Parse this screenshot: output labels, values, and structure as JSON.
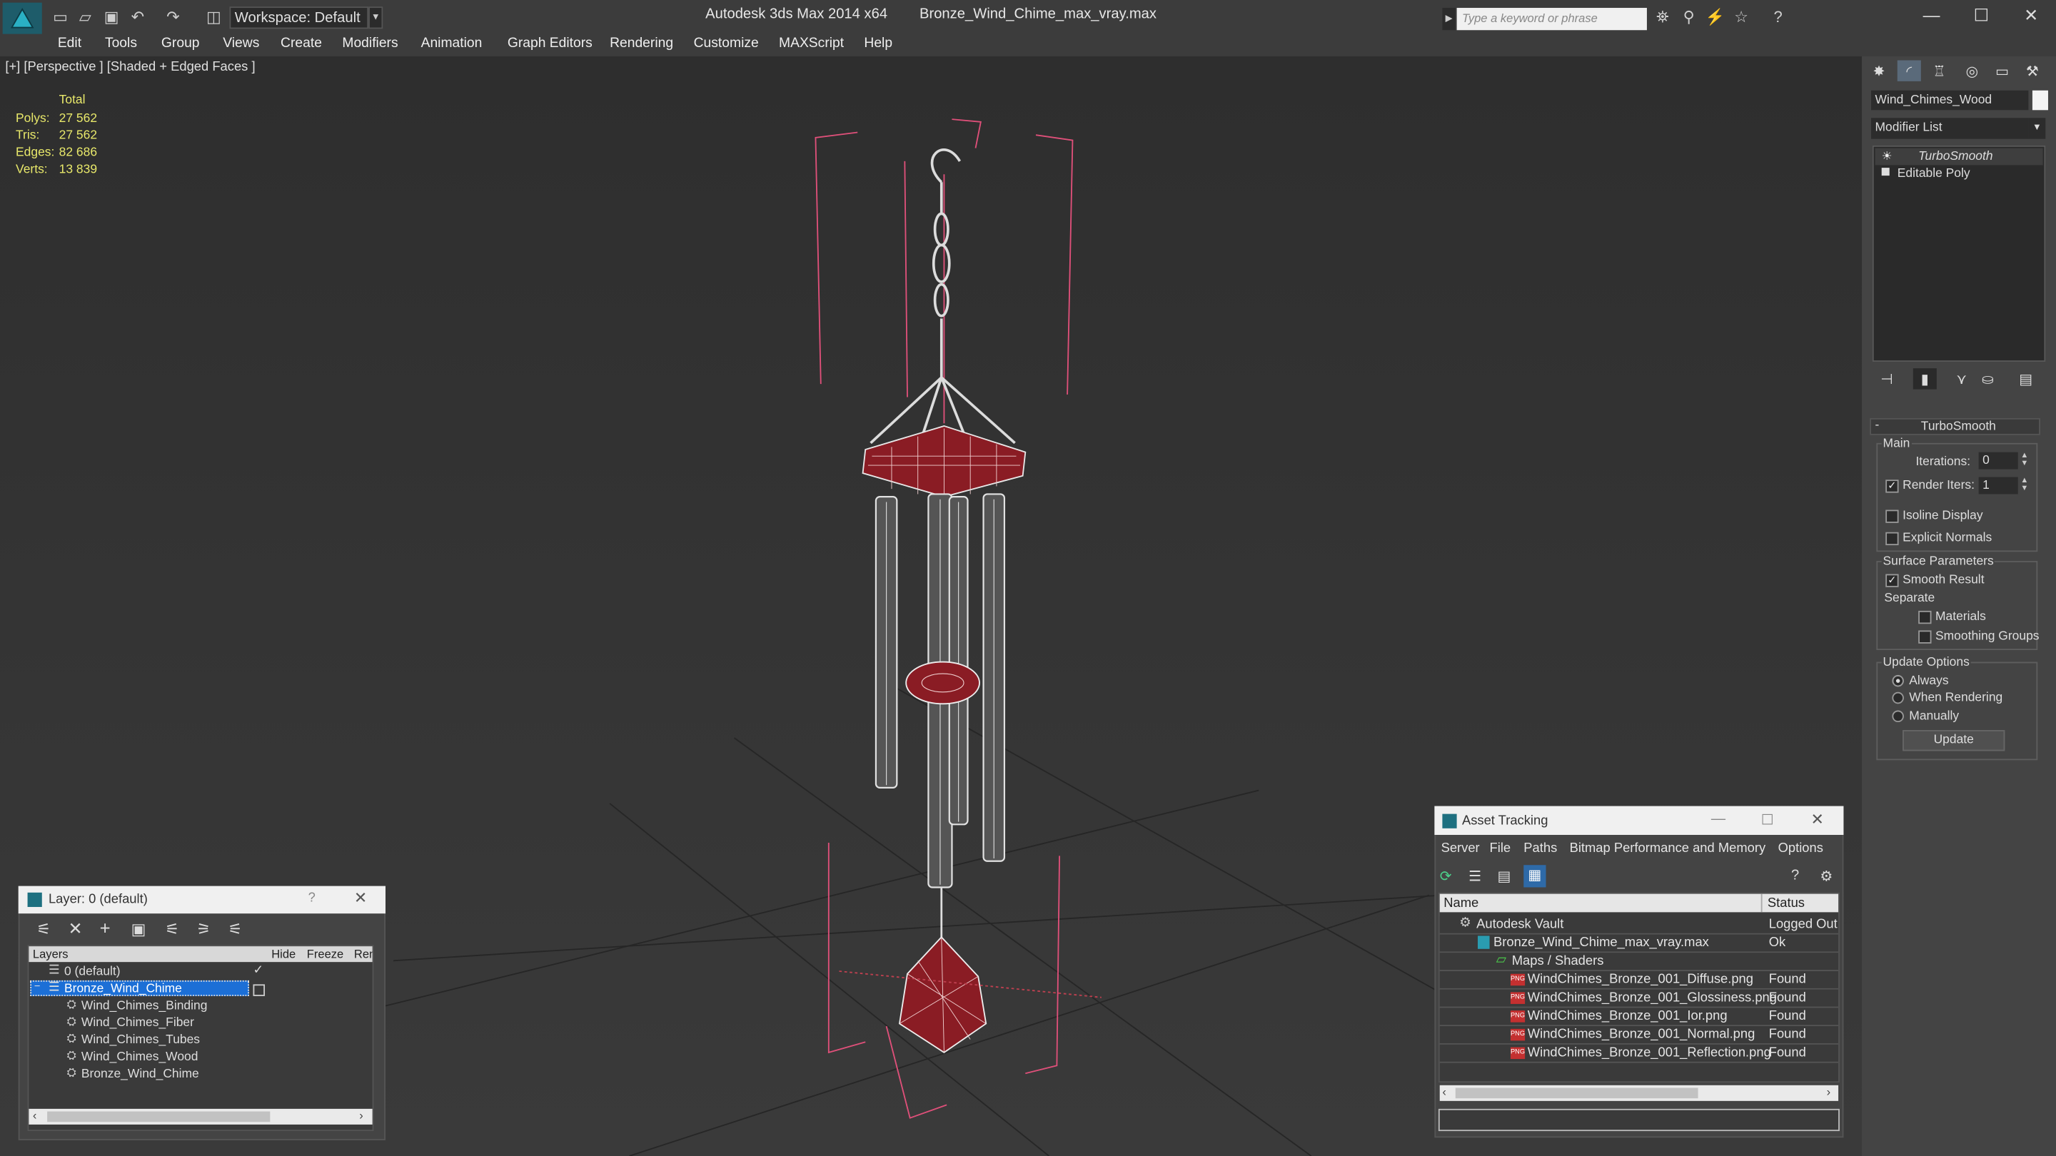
{
  "titlebar": {
    "workspace_label": "Workspace: Default",
    "title": "Autodesk 3ds Max 2014 x64        Bronze_Wind_Chime_max_vray.max",
    "search_placeholder": "Type a keyword or phrase"
  },
  "menu": [
    "Edit",
    "Tools",
    "Group",
    "Views",
    "Create",
    "Modifiers",
    "Animation",
    "Graph Editors",
    "Rendering",
    "Customize",
    "MAXScript",
    "Help"
  ],
  "viewport": {
    "label": "[+] [Perspective ] [Shaded + Edged Faces ]",
    "stats": {
      "header": "Total",
      "rows": [
        {
          "label": "Polys:",
          "value": "27 562"
        },
        {
          "label": "Tris:",
          "value": "27 562"
        },
        {
          "label": "Edges:",
          "value": "82 686"
        },
        {
          "label": "Verts:",
          "value": "13 839"
        }
      ]
    }
  },
  "command_panel": {
    "object_name": "Wind_Chimes_Wood",
    "modifier_list": "Modifier List",
    "stack": [
      "TurboSmooth",
      "Editable Poly"
    ],
    "rollout_title": "TurboSmooth",
    "main_group": "Main",
    "iterations_label": "Iterations:",
    "iterations_value": "0",
    "render_iters_label": "Render Iters:",
    "render_iters_value": "1",
    "isoline_label": "Isoline Display",
    "explicit_label": "Explicit Normals",
    "surface_group": "Surface Parameters",
    "smooth_result_label": "Smooth Result",
    "separate_label": "Separate",
    "materials_label": "Materials",
    "smoothing_groups_label": "Smoothing Groups",
    "update_group": "Update Options",
    "always_label": "Always",
    "when_rendering_label": "When Rendering",
    "manually_label": "Manually",
    "update_button": "Update"
  },
  "layer_dialog": {
    "title": "Layer: 0 (default)",
    "help": "?",
    "columns": [
      "Layers",
      "Hide",
      "Freeze",
      "Ren"
    ],
    "rows": [
      {
        "name": "0 (default)",
        "level": 0
      },
      {
        "name": "Bronze_Wind_Chime",
        "level": 0,
        "selected": true
      },
      {
        "name": "Wind_Chimes_Binding",
        "level": 1
      },
      {
        "name": "Wind_Chimes_Fiber",
        "level": 1
      },
      {
        "name": "Wind_Chimes_Tubes",
        "level": 1
      },
      {
        "name": "Wind_Chimes_Wood",
        "level": 1
      },
      {
        "name": "Bronze_Wind_Chime",
        "level": 1
      }
    ]
  },
  "asset_dialog": {
    "title": "Asset Tracking",
    "menu": [
      "Server",
      "File",
      "Paths",
      "Bitmap Performance and Memory",
      "Options"
    ],
    "columns": [
      "Name",
      "Status"
    ],
    "rows": [
      {
        "name": "Autodesk Vault",
        "status": "Logged Out"
      },
      {
        "name": "Bronze_Wind_Chime_max_vray.max",
        "status": "Ok"
      },
      {
        "name": "Maps / Shaders",
        "status": ""
      },
      {
        "name": "WindChimes_Bronze_001_Diffuse.png",
        "status": "Found"
      },
      {
        "name": "WindChimes_Bronze_001_Glossiness.png",
        "status": "Found"
      },
      {
        "name": "WindChimes_Bronze_001_Ior.png",
        "status": "Found"
      },
      {
        "name": "WindChimes_Bronze_001_Normal.png",
        "status": "Found"
      },
      {
        "name": "WindChimes_Bronze_001_Reflection.png",
        "status": "Found"
      }
    ]
  },
  "colors": {
    "selection": "#1c6fd6",
    "wire_red": "#8a1c24",
    "bbox_pink": "#e0507a",
    "stats_yellow": "#e8e86a"
  }
}
